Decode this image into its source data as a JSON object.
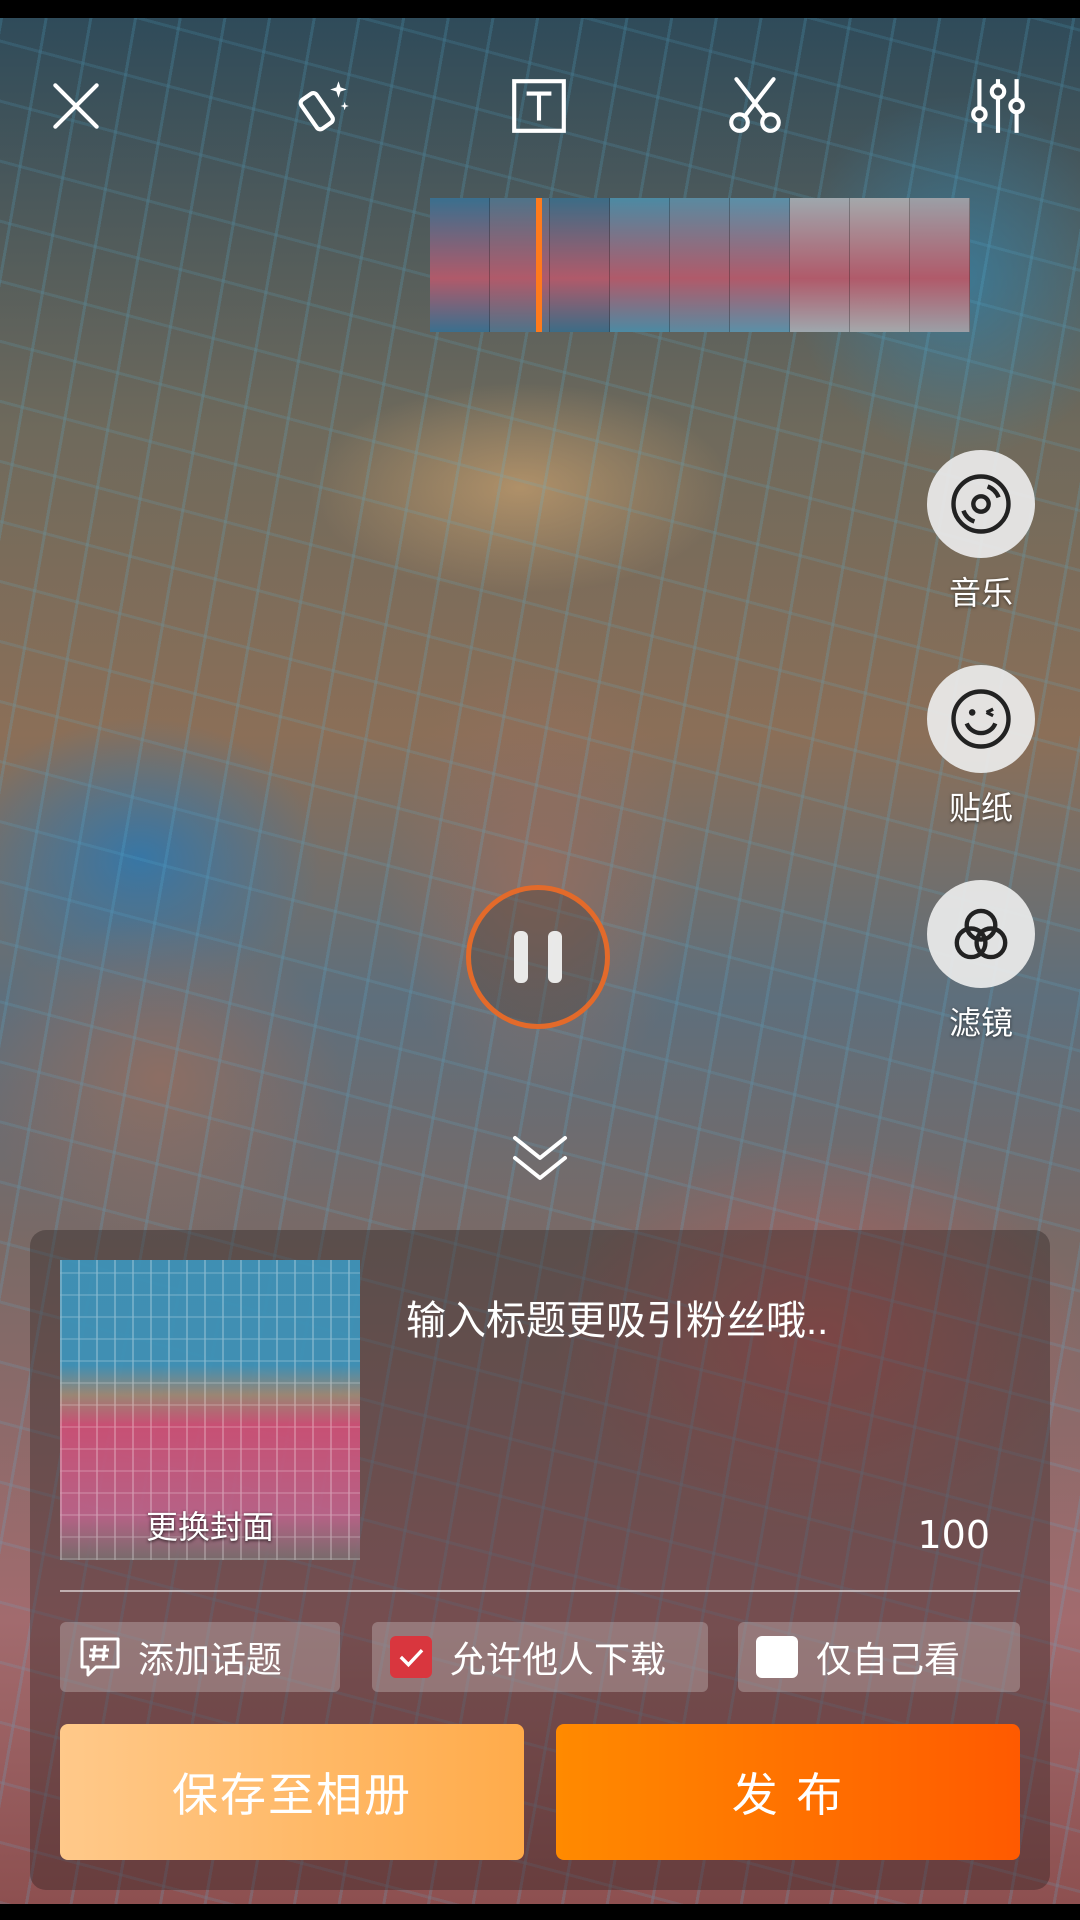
{
  "toolbar": {
    "items": [
      {
        "icon": "close-icon"
      },
      {
        "icon": "magic-wand-icon"
      },
      {
        "icon": "text-icon"
      },
      {
        "icon": "scissors-icon"
      },
      {
        "icon": "adjust-sliders-icon"
      }
    ]
  },
  "timeline": {
    "frames": [
      "#3a6f8e",
      "#4f7389",
      "#3c6c86",
      "#4c8aa3",
      "#5a8aa0",
      "#5b8fa7",
      "#9ea7ad",
      "#a4a8ab",
      "#9b9fa6"
    ]
  },
  "side_actions": [
    {
      "label": "音乐",
      "icon": "music-disc-icon"
    },
    {
      "label": "贴纸",
      "icon": "sticker-smile-icon"
    },
    {
      "label": "滤镜",
      "icon": "filter-circles-icon"
    }
  ],
  "player": {
    "state_icon": "pause-icon",
    "accent": "#e36a2a"
  },
  "publish_panel": {
    "cover_label": "更换封面",
    "title_placeholder": "输入标题更吸引粉丝哦..",
    "char_count": "100",
    "options": {
      "topic": {
        "label": "添加话题",
        "icon": "hashtag-bubble-icon"
      },
      "allow_download": {
        "label": "允许他人下载",
        "checked": true,
        "color": "#d9363e"
      },
      "private": {
        "label": "仅自己看",
        "checked": false
      }
    },
    "save_button": "保存至相册",
    "publish_button": "发 布",
    "colors": {
      "save_from": "#ffc98a",
      "save_to": "#ffab4a",
      "publish_from": "#ff8a00",
      "publish_to": "#ff5a00"
    }
  }
}
